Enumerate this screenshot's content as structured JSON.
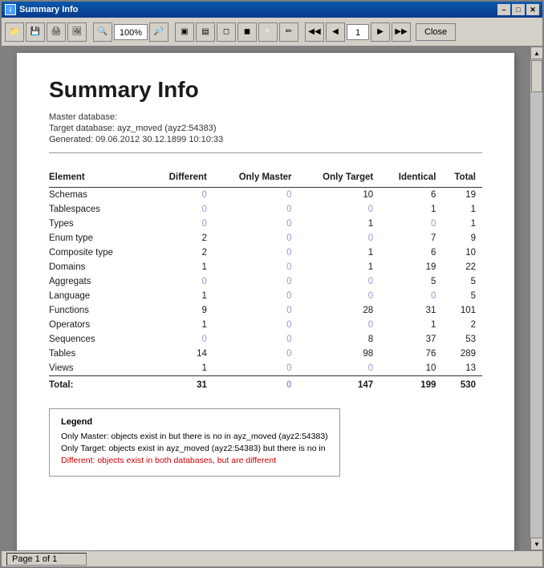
{
  "window": {
    "title": "Summary Info"
  },
  "toolbar": {
    "zoom_value": "100%",
    "page_current": "1",
    "close_label": "Close"
  },
  "report": {
    "title": "Summary Info",
    "meta": {
      "master_label": "Master database:",
      "target_label": "Target database: ayz_moved (ayz2:54383)",
      "generated_label": "Generated: 09.06.2012 30.12.1899 10:10:33"
    },
    "table": {
      "headers": [
        "Element",
        "Different",
        "Only Master",
        "Only Target",
        "Identical",
        "Total"
      ],
      "rows": [
        {
          "element": "Schemas",
          "different": "0",
          "only_master": "0",
          "only_target": "10",
          "identical": "6",
          "total": "19"
        },
        {
          "element": "Tablespaces",
          "different": "0",
          "only_master": "0",
          "only_target": "0",
          "identical": "1",
          "total": "1"
        },
        {
          "element": "Types",
          "different": "0",
          "only_master": "0",
          "only_target": "1",
          "identical": "0",
          "total": "1"
        },
        {
          "element": "Enum type",
          "different": "2",
          "only_master": "0",
          "only_target": "0",
          "identical": "7",
          "total": "9"
        },
        {
          "element": "Composite type",
          "different": "2",
          "only_master": "0",
          "only_target": "1",
          "identical": "6",
          "total": "10"
        },
        {
          "element": "Domains",
          "different": "1",
          "only_master": "0",
          "only_target": "1",
          "identical": "19",
          "total": "22"
        },
        {
          "element": "Aggregats",
          "different": "0",
          "only_master": "0",
          "only_target": "0",
          "identical": "5",
          "total": "5"
        },
        {
          "element": "Language",
          "different": "1",
          "only_master": "0",
          "only_target": "0",
          "identical": "0",
          "total": "5"
        },
        {
          "element": "Functions",
          "different": "9",
          "only_master": "0",
          "only_target": "28",
          "identical": "31",
          "total": "101"
        },
        {
          "element": "Operators",
          "different": "1",
          "only_master": "0",
          "only_target": "0",
          "identical": "1",
          "total": "2"
        },
        {
          "element": "Sequences",
          "different": "0",
          "only_master": "0",
          "only_target": "8",
          "identical": "37",
          "total": "53"
        },
        {
          "element": "Tables",
          "different": "14",
          "only_master": "0",
          "only_target": "98",
          "identical": "76",
          "total": "289"
        },
        {
          "element": "Views",
          "different": "1",
          "only_master": "0",
          "only_target": "0",
          "identical": "10",
          "total": "13"
        }
      ],
      "total_row": {
        "label": "Total:",
        "different": "31",
        "only_master": "0",
        "only_target": "147",
        "identical": "199",
        "total": "530"
      }
    },
    "legend": {
      "title": "Legend",
      "items": [
        {
          "label": "Only Master: objects exist in  but there is no in ayz_moved (ayz2:54383)",
          "type": "normal"
        },
        {
          "label": "Only Target: objects exist in ayz_moved (ayz2:54383) but there is no in",
          "type": "normal"
        },
        {
          "label": "Different:  objects exist in both databases, but are different",
          "type": "different"
        }
      ]
    }
  },
  "statusbar": {
    "page_info": "Page 1 of 1"
  },
  "zero_color": "#9999cc",
  "nonzero_color": "#1a1a1a"
}
